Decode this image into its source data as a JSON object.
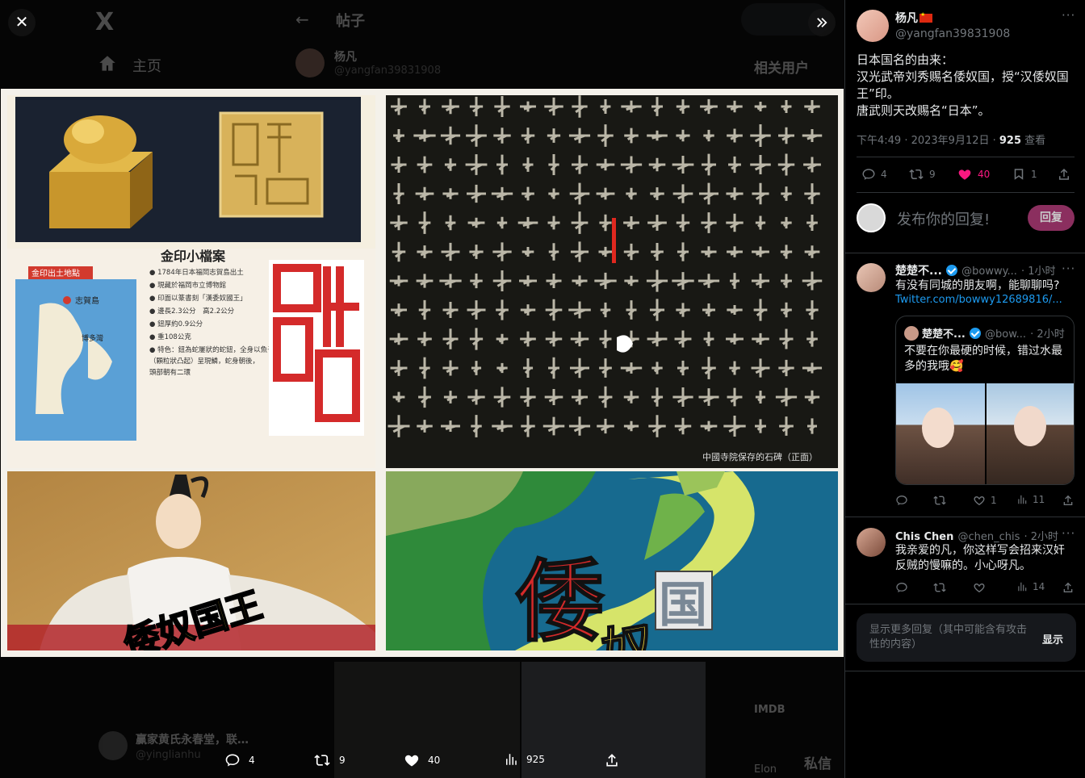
{
  "background": {
    "logo": "X",
    "nav_home": "主页",
    "back_arrow": "←",
    "post_title": "帖子",
    "post_author": "杨凡",
    "post_handle": "@yangfan39831908",
    "related_users": "相关用户",
    "other_author": "赢家黄氏永春堂，联…",
    "other_handle": "@yinglianhu",
    "imdb": "IMDB",
    "dm": "私信",
    "elon": "Elon"
  },
  "viewer": {
    "close_icon": "close-icon",
    "expand_icon": "chevrons-right-icon",
    "image_overlays": {
      "king_caption": "倭奴国王",
      "map_big": "倭",
      "map_sub": "奴",
      "map_box": "国",
      "seal_card_title": "金印小檔案",
      "seal_map_label": "金印出土地點",
      "seal_island": "志賀島",
      "seal_bay": "博多灣",
      "seal_facts": [
        "1784年日本福岡志賀島出土",
        "現藏於福岡市立博物館",
        "印面以篆書刻「漢委奴國王」",
        "邊長2.3公分　高2.2公分",
        "鈕厚約0.9公分",
        "重108公克",
        "特色：鈕為蛇屢狀的蛇鈕，全身以魚子文（顆粒狀凸起）呈現鱗，蛇身朝後，頭部朝有二環"
      ],
      "stele_caption": "中國寺院保存的石碑（正面）"
    },
    "actions": [
      {
        "icon": "reply-icon",
        "count": "4"
      },
      {
        "icon": "retweet-icon",
        "count": "9"
      },
      {
        "icon": "heart-icon",
        "count": "40"
      },
      {
        "icon": "views-icon",
        "count": "925"
      },
      {
        "icon": "share-icon",
        "count": ""
      }
    ]
  },
  "sidebar": {
    "author": {
      "name": "杨凡",
      "handle": "@yangfan39831908"
    },
    "tweet_text": "日本国名的由来：\n汉光武帝刘秀赐名倭奴国，授“汉倭奴国王”印。\n唐武则天改赐名“日本”。",
    "meta_time": "下午4:49 · 2023年9月12日 · ",
    "meta_views": "925",
    "meta_views_label": " 查看",
    "stats": {
      "replies": "4",
      "retweets": "9",
      "likes": "40",
      "bookmarks": "1"
    },
    "reply_placeholder": "发布你的回复!",
    "reply_button": "回复",
    "replies": [
      {
        "name": "楚楚不...",
        "handle": "@bowwy...",
        "time": "· 1小时",
        "text": "有没有同城的朋友啊，能聊聊吗?",
        "link": "Twitter.com/bowwy12689816/...",
        "quote": {
          "name": "楚楚不...",
          "handle": "@bow...",
          "time": "· 2小时",
          "text": "不要在你最硬的时候，错过水最多的我哦🥰"
        },
        "stats": {
          "replies": "",
          "retweets": "",
          "likes": "1",
          "views": "11"
        }
      },
      {
        "name": "Chis Chen",
        "handle": "@chen_chis",
        "time": "· 2小时",
        "text": "我亲爱的凡，你这样写会招来汉奸反贼的慢嘛的。小心呀凡。",
        "stats": {
          "replies": "",
          "retweets": "",
          "likes": "",
          "views": "14"
        }
      }
    ],
    "show_more": {
      "text": "显示更多回复（其中可能含有攻击性的内容）",
      "button": "显示"
    }
  }
}
